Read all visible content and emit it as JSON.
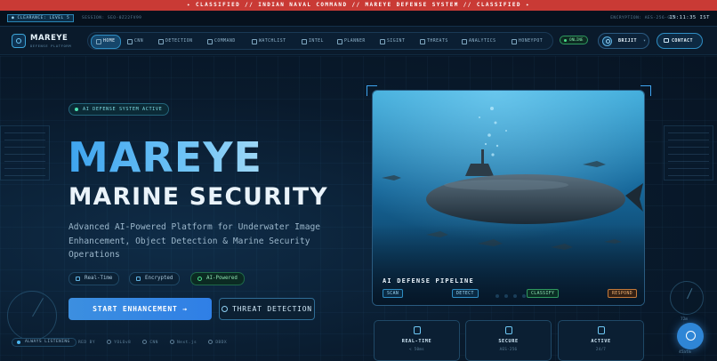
{
  "banner": {
    "text": "✦ CLASSIFIED // INDIAN NAVAL COMMAND // MAREYE DEFENSE SYSTEM // CLASSIFIED ✦"
  },
  "statusbar": {
    "clearance": "● CLEARANCE: LEVEL 5",
    "session": "SESSION: SEO-0Z22FV99",
    "encryption": "ENCRYPTION: AES-256-GCM",
    "clock": "15:11:35 IST"
  },
  "brand": {
    "name": "MAREYE",
    "subtitle": "DEFENSE PLATFORM"
  },
  "nav": {
    "items": [
      {
        "label": "HOME",
        "icon": "home-icon"
      },
      {
        "label": "CNN",
        "icon": "cnn-icon"
      },
      {
        "label": "DETECTION",
        "icon": "detection-icon"
      },
      {
        "label": "COMMAND",
        "icon": "command-icon"
      },
      {
        "label": "WATCHLIST",
        "icon": "watchlist-icon"
      },
      {
        "label": "INTEL",
        "icon": "intel-icon"
      },
      {
        "label": "PLANNER",
        "icon": "planner-icon"
      },
      {
        "label": "SIGINT",
        "icon": "sigint-icon"
      },
      {
        "label": "THREATS",
        "icon": "threats-icon"
      },
      {
        "label": "ANALYTICS",
        "icon": "analytics-icon"
      },
      {
        "label": "HONEYPOT",
        "icon": "honeypot-icon"
      }
    ],
    "online": "ONLINE",
    "user": "BRIJIT",
    "contact": "CONTACT"
  },
  "hero": {
    "badge": "AI DEFENSE SYSTEM ACTIVE",
    "title_line1": "MAREYE",
    "title_line2": "MARINE SECURITY",
    "description": "Advanced AI-Powered Platform for Underwater Image Enhancement, Object Detection & Marine Security Operations",
    "features": [
      "Real-Time",
      "Encrypted",
      "AI-Powered"
    ],
    "primary_button": "START ENHANCEMENT →",
    "secondary_button": "THREAT DETECTION",
    "tech_prefix": "RED BY",
    "tech": [
      "YOLOv8",
      "CNN",
      "Next.js",
      "DBDX"
    ],
    "listening": "ALWAYS LISTENING"
  },
  "pipeline": {
    "title": "AI DEFENSE PIPELINE",
    "stages": [
      "SCAN",
      "DETECT",
      "CLASSIFY",
      "RESPOND"
    ]
  },
  "stats": [
    {
      "label": "REAL-TIME",
      "sub": "< 50ms"
    },
    {
      "label": "SECURE",
      "sub": "AES-256"
    },
    {
      "label": "ACTIVE",
      "sub": "24/7"
    }
  ],
  "gauge": {
    "value": "72m",
    "label": "45atm"
  },
  "colors": {
    "accent": "#3ea4ef",
    "banner": "#c93a35",
    "online": "#4be08a",
    "respond": "#f2b070"
  }
}
